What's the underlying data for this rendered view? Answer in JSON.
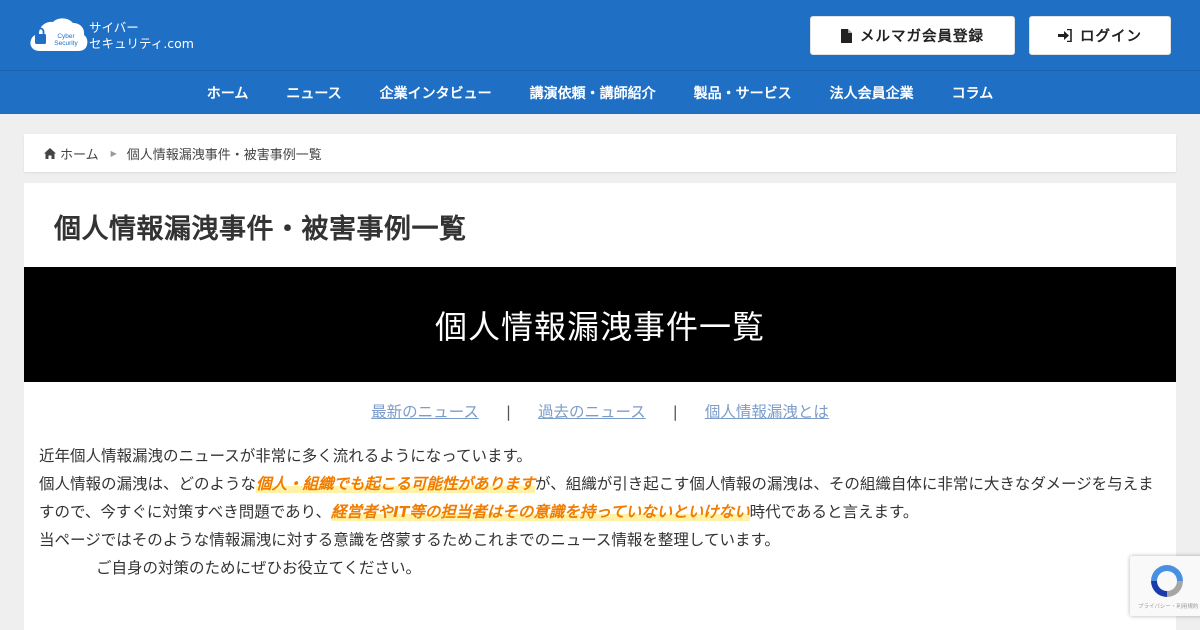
{
  "header": {
    "logo_badge_line1": "Cyber",
    "logo_badge_line2": "Security",
    "logo_line1": "サイバー",
    "logo_line2": "セキュリティ.com",
    "mail_button": "メルマガ会員登録",
    "login_button": "ログイン"
  },
  "nav": {
    "items": [
      "ホーム",
      "ニュース",
      "企業インタビュー",
      "講演依頼・講師紹介",
      "製品・サービス",
      "法人会員企業",
      "コラム"
    ]
  },
  "breadcrumb": {
    "home": "ホーム",
    "current": "個人情報漏洩事件・被害事例一覧"
  },
  "main": {
    "title": "個人情報漏洩事件・被害事例一覧",
    "banner": "個人情報漏洩事件一覧",
    "sublinks": [
      "最新のニュース",
      "過去のニュース",
      "個人情報漏洩とは"
    ],
    "separator": "|",
    "paragraph1": "近年個人情報漏洩のニュースが非常に多く流れるようになっています。",
    "p2_a": "個人情報の漏洩は、どのような",
    "p2_hl1": "個人・組織でも起こる可能性があります",
    "p2_b": "が、組織が引き起こす個人情報の漏洩は、その組織自体に非常に大きなダメージを与えますので、今すぐに対策すべき問題であり、",
    "p2_hl2": "経営者やIT等の担当者はその意識を持っていないといけない",
    "p2_c": "時代であると言えます。",
    "paragraph3": "当ページではそのような情報漏洩に対する意識を啓蒙するためこれまでのニュース情報を整理しています。",
    "paragraph4": "ご自身の対策のためにぜひお役立てください。"
  },
  "recaptcha": {
    "caption": "プライバシー・利用規約"
  },
  "colors": {
    "brand_blue": "#1f6fc5",
    "highlight_orange": "#f07c00",
    "link_blue": "#7c9cc9"
  }
}
